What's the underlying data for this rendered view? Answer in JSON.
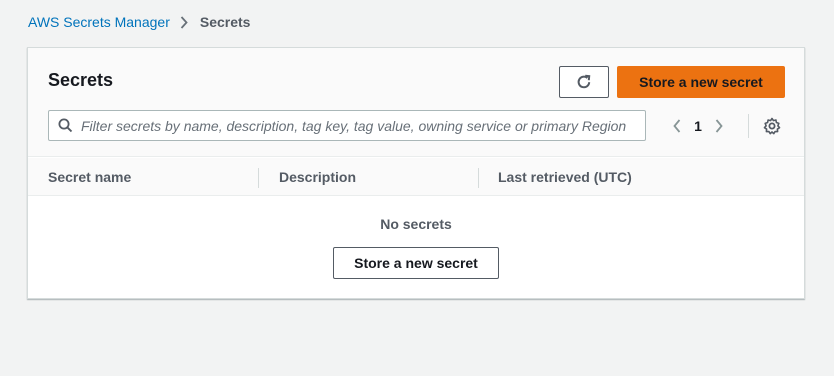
{
  "breadcrumb": {
    "parent": "AWS Secrets Manager",
    "current": "Secrets"
  },
  "panel": {
    "title": "Secrets",
    "primary_button": "Store a new secret",
    "search_placeholder": "Filter secrets by name, description, tag key, tag value, owning service or primary Region",
    "current_page": "1"
  },
  "table": {
    "columns": [
      "Secret name",
      "Description",
      "Last retrieved (UTC)"
    ],
    "empty_text": "No secrets",
    "empty_button": "Store a new secret"
  },
  "icons": {
    "breadcrumb_separator": "chevron-right-icon",
    "refresh": "refresh-icon",
    "search": "search-icon",
    "prev": "chevron-left-icon",
    "next": "chevron-right-icon",
    "settings": "gear-icon"
  },
  "colors": {
    "background": "#f2f3f3",
    "link": "#0073bb",
    "primary": "#ec7211",
    "text": "#16191f",
    "muted": "#545b64"
  }
}
